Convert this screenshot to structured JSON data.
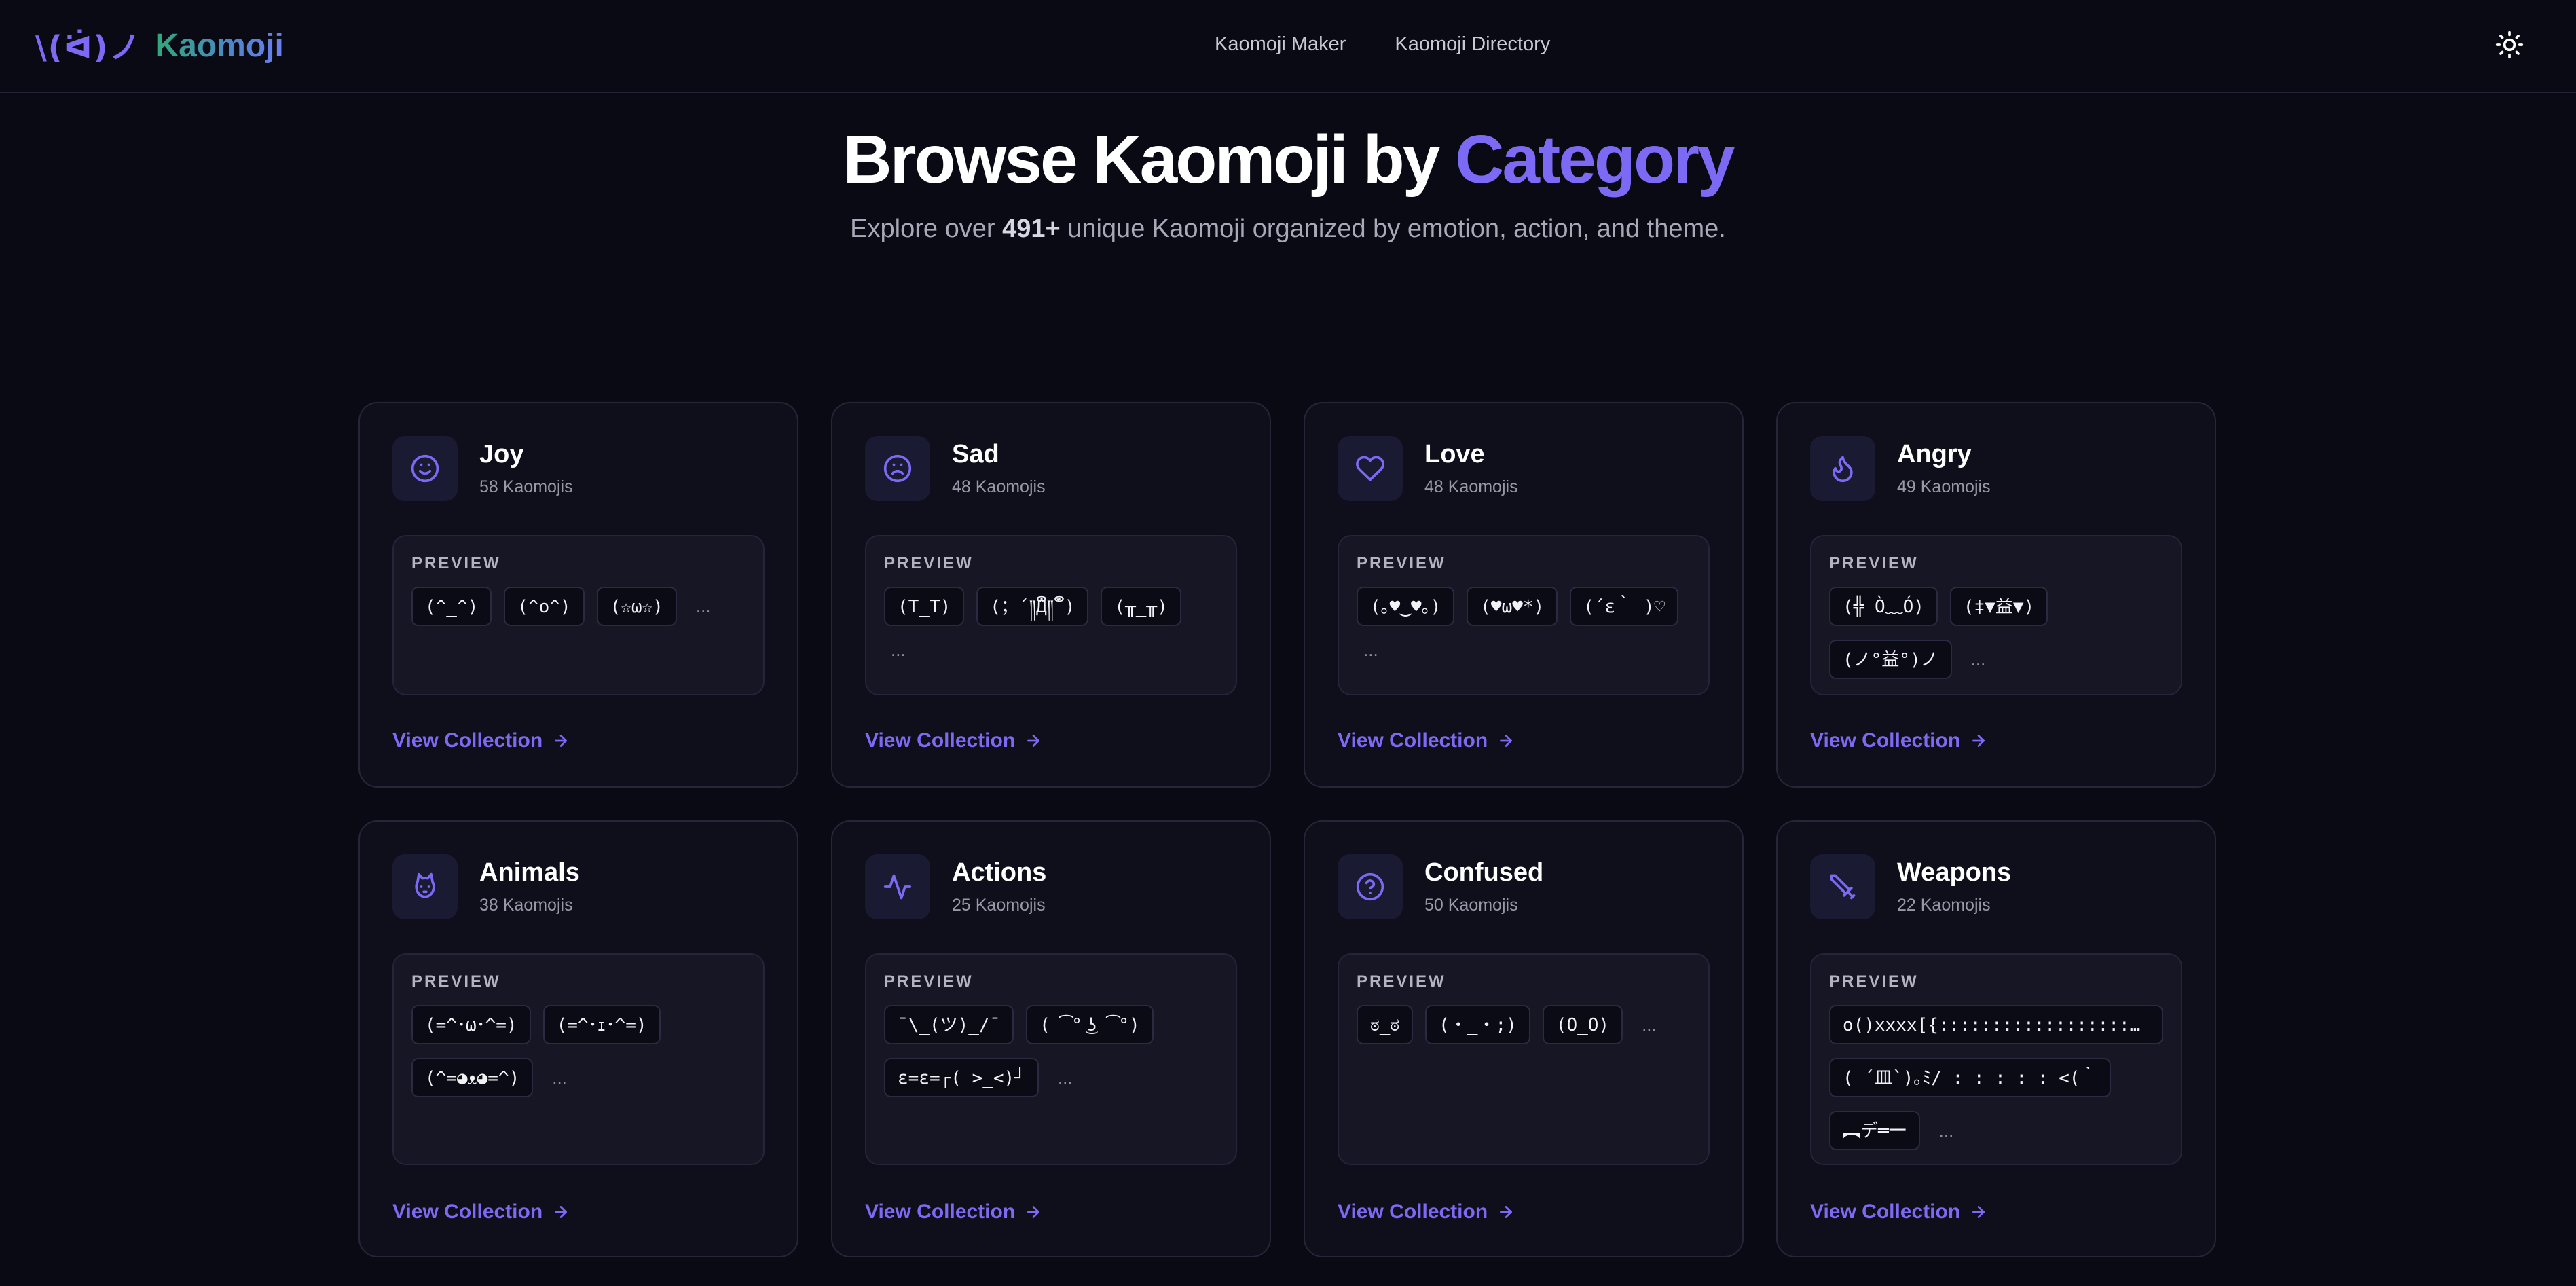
{
  "header": {
    "logo_mark": "\\(ᐛ)ノ",
    "logo_text": "Kaomoji",
    "nav": [
      "Kaomoji Maker",
      "Kaomoji Directory"
    ],
    "theme_icon": "sun-icon"
  },
  "hero": {
    "title_main": "Browse Kaomoji by ",
    "title_accent": "Category",
    "subtitle_pre": "Explore over ",
    "subtitle_count": "491+",
    "subtitle_post": " unique Kaomoji organized by emotion, action, and theme."
  },
  "preview_label": "PREVIEW",
  "more_label": "...",
  "view_label": "View Collection",
  "colors": {
    "accent": "#7c6af5",
    "background": "#0a0a14",
    "card": "#0f0f1c"
  },
  "categories": [
    {
      "name": "Joy",
      "count": "58 Kaomojis",
      "icon": "smile-icon",
      "preview": [
        "(^_^)",
        "(^o^)",
        "(☆ω☆)"
      ]
    },
    {
      "name": "Sad",
      "count": "48 Kaomojis",
      "icon": "frown-icon",
      "preview": [
        "(T_T)",
        "(；´༎ຶД༎ຶ`)",
        "(╥_╥)"
      ]
    },
    {
      "name": "Love",
      "count": "48 Kaomojis",
      "icon": "heart-icon",
      "preview": [
        "(｡♥‿♥｡)",
        "(♥ω♥*)",
        "(´ε｀ )♡"
      ]
    },
    {
      "name": "Angry",
      "count": "49 Kaomojis",
      "icon": "flame-icon",
      "preview": [
        "(╬ Ò﹏Ó)",
        "(‡▼益▼)",
        "(ノ°益°)ノ"
      ]
    },
    {
      "name": "Animals",
      "count": "38 Kaomojis",
      "icon": "cat-icon",
      "preview": [
        "(=^･ω･^=)",
        "(=^･ｪ･^=)",
        "(^=◕ᴥ◕=^)"
      ]
    },
    {
      "name": "Actions",
      "count": "25 Kaomojis",
      "icon": "activity-icon",
      "preview": [
        "¯\\_(ツ)_/¯",
        "( ͡° ͜ʖ ͡°)",
        "ε=ε=┌( >_<)┘"
      ]
    },
    {
      "name": "Confused",
      "count": "50 Kaomojis",
      "icon": "help-circle-icon",
      "preview": [
        "ಠ_ಠ",
        "(・_・;)",
        "(O_O)"
      ]
    },
    {
      "name": "Weapons",
      "count": "22 Kaomojis",
      "icon": "sword-icon",
      "preview": [
        "o()xxxx[{::::::::::::::::::::::::::::::::>",
        "( ´皿`)｡ﾐ/ : : : : : <(｀",
        "︻デ═一"
      ]
    }
  ]
}
